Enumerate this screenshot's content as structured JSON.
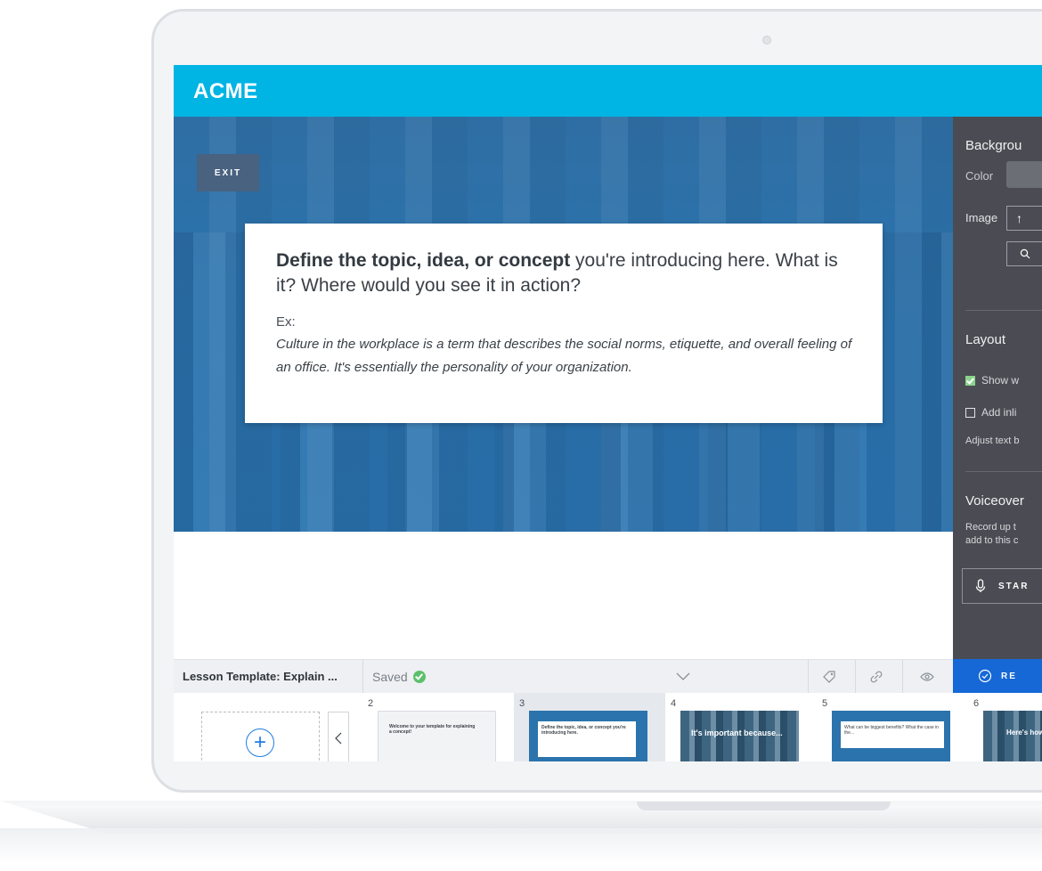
{
  "app": {
    "brand": "ACME",
    "exit_label": "EXIT"
  },
  "slide": {
    "heading_bold": "Define the topic, idea, or concept",
    "heading_rest": " you're introducing here. What is it? Where would you see it in action?",
    "ex_label": "Ex:",
    "example": "Culture in the workplace is a term that describes the social norms, etiquette, and overall feeling of an office. It's essentially the personality of your organization."
  },
  "panel": {
    "background_title": "Backgrou",
    "color_label": "Color",
    "image_label": "Image",
    "upload_icon": "↑",
    "search_icon": "search-icon",
    "layout_title": "Layout",
    "show_label": "Show w",
    "show_checked": true,
    "inline_label": "Add inli",
    "inline_checked": false,
    "adjust_label": "Adjust text b",
    "voiceover_title": "Voiceover",
    "voiceover_desc_1": "Record up t",
    "voiceover_desc_2": "add to this c",
    "start_label": "STAR"
  },
  "toolbar": {
    "lesson_title": "Lesson Template: Explain ...",
    "saved_label": "Saved",
    "review_label": "RE"
  },
  "filmstrip": {
    "slides": [
      {
        "num": "2",
        "kind": "light",
        "title": "Welcome to your template for explaining a concept!"
      },
      {
        "num": "3",
        "kind": "blue",
        "title": "Define the topic, idea, or concept you're introducing here."
      },
      {
        "num": "4",
        "kind": "photo",
        "title": "It's important because..."
      },
      {
        "num": "5",
        "kind": "blue",
        "title": "What can be biggest benefits? What the case in the..."
      },
      {
        "num": "6",
        "kind": "photo",
        "title": "Here's how"
      }
    ]
  },
  "colors": {
    "brand": "#00b4e4",
    "panel": "#4b4c53",
    "review": "#1668d6",
    "saved": "#5cc06b"
  }
}
